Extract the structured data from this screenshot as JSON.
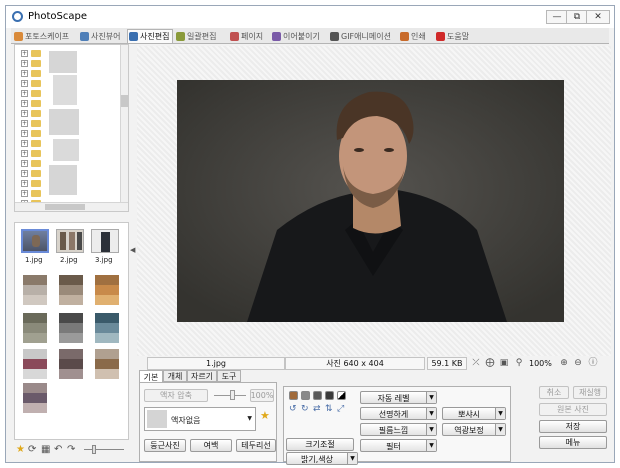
{
  "window": {
    "title": "PhotoScape",
    "controls": [
      "minimize",
      "restore",
      "close"
    ],
    "control_glyphs": {
      "minimize": "—",
      "restore": "⧉",
      "close": "✕"
    }
  },
  "tabs": [
    {
      "label": "포토스케이프",
      "icon": "photoscape-icon",
      "color": "#d98a3a"
    },
    {
      "label": "사진뷰어",
      "icon": "viewer-icon",
      "color": "#4f7fb8"
    },
    {
      "label": "사진편집",
      "icon": "editor-icon",
      "color": "#3a6fb0",
      "active": true
    },
    {
      "label": "일괄편집",
      "icon": "batch-icon",
      "color": "#8a9a3a"
    },
    {
      "label": "페이지",
      "icon": "page-icon",
      "color": "#c05050"
    },
    {
      "label": "이어붙이기",
      "icon": "combine-icon",
      "color": "#7a5aa8"
    },
    {
      "label": "GIF애니메이션",
      "icon": "gif-icon",
      "color": "#555555"
    },
    {
      "label": "인쇄",
      "icon": "print-icon",
      "color": "#c86a2a"
    },
    {
      "label": "도움말",
      "icon": "help-icon",
      "color": "#d02a2a"
    }
  ],
  "thumbnails": [
    {
      "label": "1.jpg",
      "selected": true
    },
    {
      "label": "2.jpg"
    },
    {
      "label": "3.jpg"
    }
  ],
  "status": {
    "filename": "1.jpg",
    "dimensions": "사진 640 x 404",
    "filesize": "59.1 KB",
    "zoom": "100%"
  },
  "panel": {
    "tabs": [
      "기본",
      "개체",
      "자르기",
      "도구"
    ],
    "frame_compress": "액자 압축",
    "frame_percent": "100%",
    "frame_select": "액자없음",
    "buttons_bottom": [
      "둥근사진",
      "여백",
      "테두리선"
    ],
    "auto_level": "자동 레벨",
    "sharpen": "선명하게",
    "film_effect": "필름느낌",
    "resize": "크기조절",
    "brightness": "밝기,색상",
    "filter": "필터",
    "bloom": "뽀샤시",
    "backlight": "역광보정",
    "undo": "취소",
    "redo": "재실행",
    "original": "원본 사진",
    "save": "저장",
    "menu": "메뉴"
  }
}
